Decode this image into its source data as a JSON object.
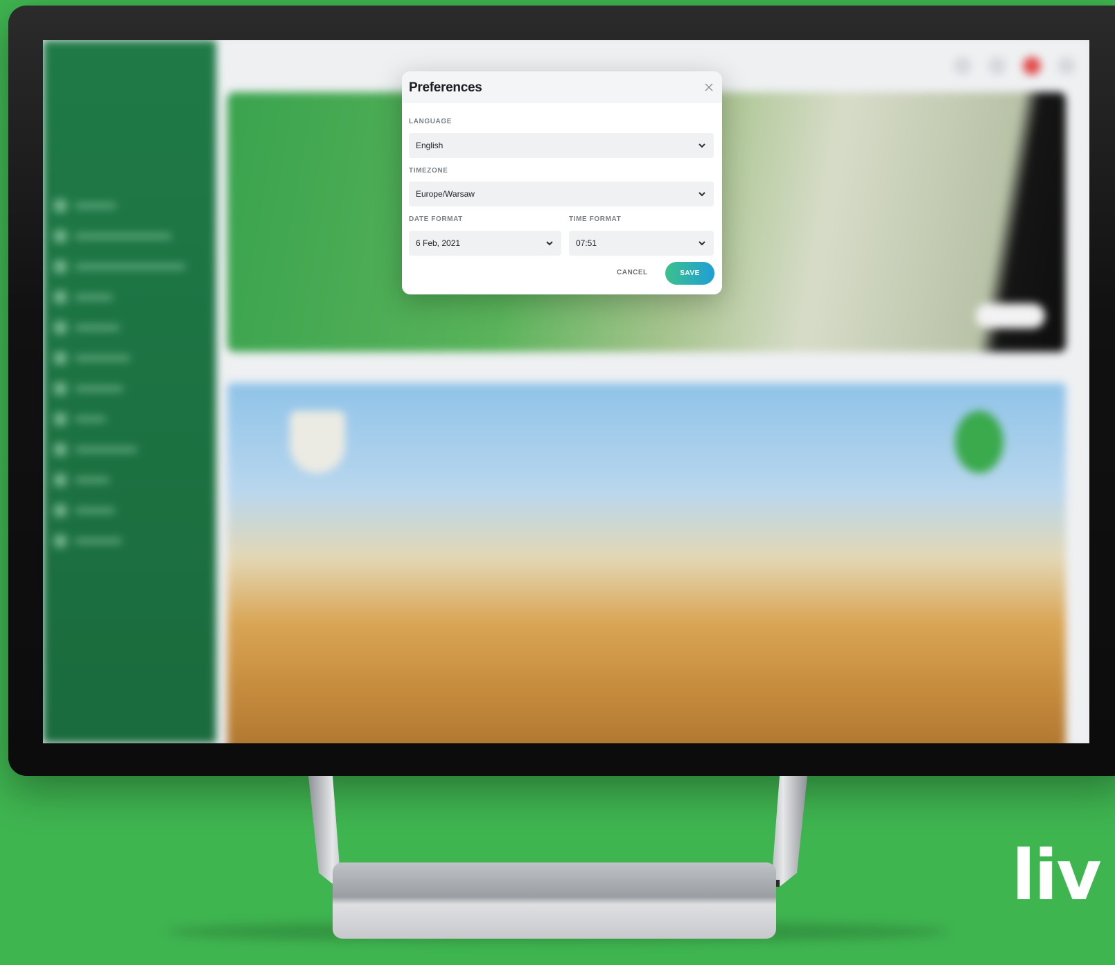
{
  "dialog": {
    "title": "Preferences",
    "language": {
      "label": "LANGUAGE",
      "value": "English"
    },
    "timezone": {
      "label": "TIMEZONE",
      "value": "Europe/Warsaw"
    },
    "date_format": {
      "label": "DATE FORMAT",
      "value": "6 Feb, 2021"
    },
    "time_format": {
      "label": "TIME FORMAT",
      "value": "07:51"
    },
    "cancel_label": "CANCEL",
    "save_label": "SAVE"
  },
  "colors": {
    "background": "#3fb550",
    "sidebar": "#1f7a47",
    "save_gradient_start": "#3cc08c",
    "save_gradient_end": "#1f9fd6"
  },
  "icons": {
    "close": "close-icon",
    "chevron": "chevron-down-icon"
  },
  "brand": {
    "logo_text": "liv"
  }
}
